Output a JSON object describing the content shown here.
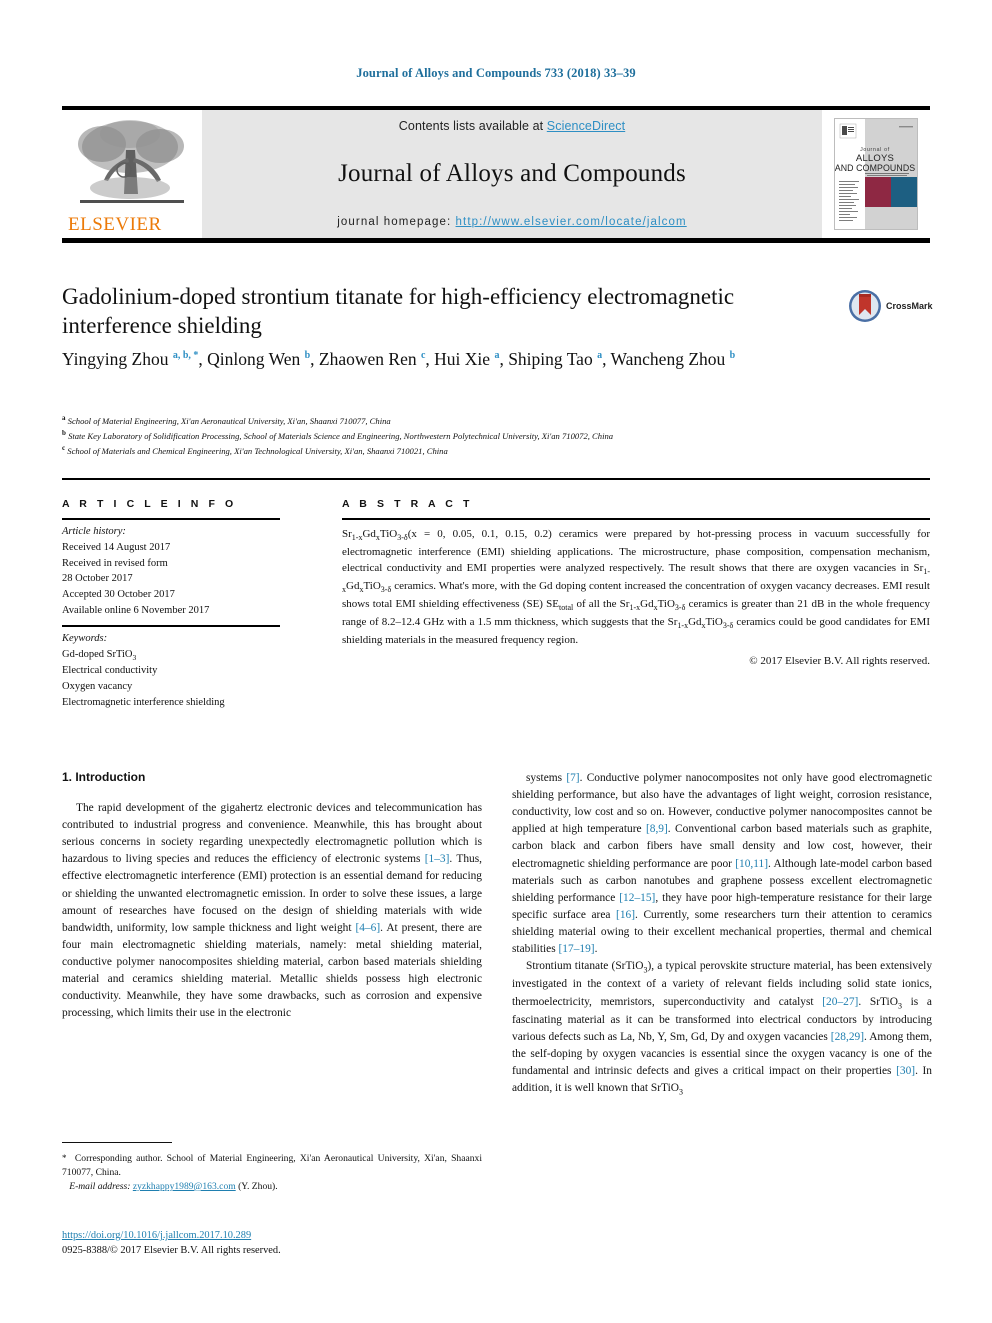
{
  "running_head": "Journal of Alloys and Compounds 733 (2018) 33–39",
  "masthead": {
    "contents_prefix": "Contents lists available at ",
    "sciencedirect": "ScienceDirect",
    "journal_title": "Journal of Alloys and Compounds",
    "homepage_label": "journal homepage:",
    "homepage_url": "http://www.elsevier.com/locate/jalcom",
    "publisher": "ELSEVIER",
    "cover_line1": "Journal of",
    "cover_line2": "ALLOYS",
    "cover_line3": "AND COMPOUNDS"
  },
  "article": {
    "title": "Gadolinium-doped strontium titanate for high-efficiency electromagnetic interference shielding",
    "crossmark_label": "CrossMark",
    "authors_html": "Yingying Zhou <sup>a, b, *</sup>, Qinlong Wen <sup>b</sup>, Zhaowen Ren <sup>c</sup>, Hui Xie <sup>a</sup>, Shiping Tao <sup>a</sup>, Wancheng Zhou <sup>b</sup>",
    "affiliations": [
      "School of Material Engineering, Xi'an Aeronautical University, Xi'an, Shaanxi 710077, China",
      "State Key Laboratory of Solidification Processing, School of Materials Science and Engineering, Northwestern Polytechnical University, Xi'an 710072, China",
      "School of Materials and Chemical Engineering, Xi'an Technological University, Xi'an, Shaanxi 710021, China"
    ],
    "affiliation_marks": [
      "a",
      "b",
      "c"
    ]
  },
  "article_info": {
    "heading": "A R T I C L E   I N F O",
    "history_label": "Article history:",
    "history": [
      "Received 14 August 2017",
      "Received in revised form",
      "28 October 2017",
      "Accepted 30 October 2017",
      "Available online 6 November 2017"
    ],
    "keywords_label": "Keywords:",
    "keywords_html": [
      "Gd-doped SrTiO<sub>3</sub>",
      "Electrical conductivity",
      "Oxygen vacancy",
      "Electromagnetic interference shielding"
    ]
  },
  "abstract": {
    "heading": "A B S T R A C T",
    "body_html": "Sr<sub>1-x</sub>Gd<sub>x</sub>TiO<sub>3-&delta;</sub>(x&nbsp;=&nbsp;0, 0.05, 0.1, 0.15, 0.2) ceramics were prepared by hot-pressing process in vacuum successfully for electromagnetic interference (EMI) shielding applications. The microstructure, phase composition, compensation mechanism, electrical conductivity and EMI properties were analyzed respectively. The result shows that there are oxygen vacancies in Sr<sub>1-x</sub>Gd<sub>x</sub>TiO<sub>3-&delta;</sub> ceramics. What's more, with the Gd doping content increased the concentration of oxygen vacancy decreases. EMI result shows total EMI shielding effectiveness (SE) SE<sub>total</sub> of all the Sr<sub>1-x</sub>Gd<sub>x</sub>TiO<sub>3-&delta;</sub> ceramics is greater than 21 dB in the whole frequency range of 8.2&ndash;12.4 GHz with a 1.5 mm thickness, which suggests that the Sr<sub>1-x</sub>Gd<sub>x</sub>TiO<sub>3-&delta;</sub> ceramics could be good candidates for EMI shielding materials in the measured frequency region.",
    "copyright": "© 2017 Elsevier B.V. All rights reserved."
  },
  "body": {
    "section_heading": "1.  Introduction",
    "left_column_html": "The rapid development of the gigahertz electronic devices and telecommunication has contributed to industrial progress and convenience. Meanwhile, this has brought about serious concerns in society regarding unexpectedly electromagnetic pollution which is hazardous to living species and reduces the efficiency of electronic systems <span class=\"ref\">[1&ndash;3]</span>. Thus, effective electromagnetic interference (EMI) protection is an essential demand for reducing or shielding the unwanted electromagnetic emission. In order to solve these issues, a large amount of researches have focused on the design of shielding materials with wide bandwidth, uniformity, low sample thickness and light weight <span class=\"ref\">[4&ndash;6]</span>. At present, there are four main electromagnetic shielding materials, namely: metal shielding material, conductive polymer nanocomposites shielding material, carbon based materials shielding material and ceramics shielding material. Metallic shields possess high electronic conductivity. Meanwhile, they have some drawbacks, such as corrosion and expensive processing, which limits their use in the electronic",
    "right_column_paragraph1_html": "systems <span class=\"ref\">[7]</span>. Conductive polymer nanocomposites not only have good electromagnetic shielding performance, but also have the advantages of light weight, corrosion resistance, conductivity, low cost and so on. However, conductive polymer nanocomposites cannot be applied at high temperature <span class=\"ref\">[8,9]</span>. Conventional carbon based materials such as graphite, carbon black and carbon fibers have small density and low cost, however, their electromagnetic shielding performance are poor <span class=\"ref\">[10,11]</span>. Although late-model carbon based materials such as carbon nanotubes and graphene possess excellent electromagnetic shielding performance <span class=\"ref\">[12&ndash;15]</span>, they have poor high-temperature resistance for their large specific surface area <span class=\"ref\">[16]</span>. Currently, some researchers turn their attention to ceramics shielding material owing to their excellent mechanical properties, thermal and chemical stabilities <span class=\"ref\">[17&ndash;19]</span>.",
    "right_column_paragraph2_html": "Strontium titanate (SrTiO<sub>3</sub>), a typical perovskite structure material, has been extensively investigated in the context of a variety of relevant fields including solid state ionics, thermoelectricity, memristors, superconductivity and catalyst <span class=\"ref\">[20&ndash;27]</span>. SrTiO<sub>3</sub> is a fascinating material as it can be transformed into electrical conductors by introducing various defects such as La, Nb, Y, Sm, Gd, Dy and oxygen vacancies <span class=\"ref\">[28,29]</span>. Among them, the self-doping by oxygen vacancies is essential since the oxygen vacancy is one of the fundamental and intrinsic defects and gives a critical impact on their properties <span class=\"ref\">[30]</span>. In addition, it is well known that SrTiO<sub>3</sub>"
  },
  "footer": {
    "corresponding_html": "<span class=\"star\">*</span>&nbsp; Corresponding author. School of Material Engineering, Xi'an Aeronautical University, Xi'an, Shaanxi 710077, China.",
    "email_label": "E-mail address:",
    "email": "zyzkhappy1989@163.com",
    "email_suffix": "(Y. Zhou).",
    "doi": "https://doi.org/10.1016/j.jallcom.2017.10.289",
    "issn_line": "0925-8388/© 2017 Elsevier B.V. All rights reserved."
  },
  "colors": {
    "link_blue": "#1f7fb0",
    "sciencedirect_blue": "#2e8fc4",
    "elsevier_orange": "#ec7a08",
    "masthead_grey": "#e6e6e6",
    "cover_maroon": "#8e2843",
    "cover_teal": "#1d5f82"
  }
}
